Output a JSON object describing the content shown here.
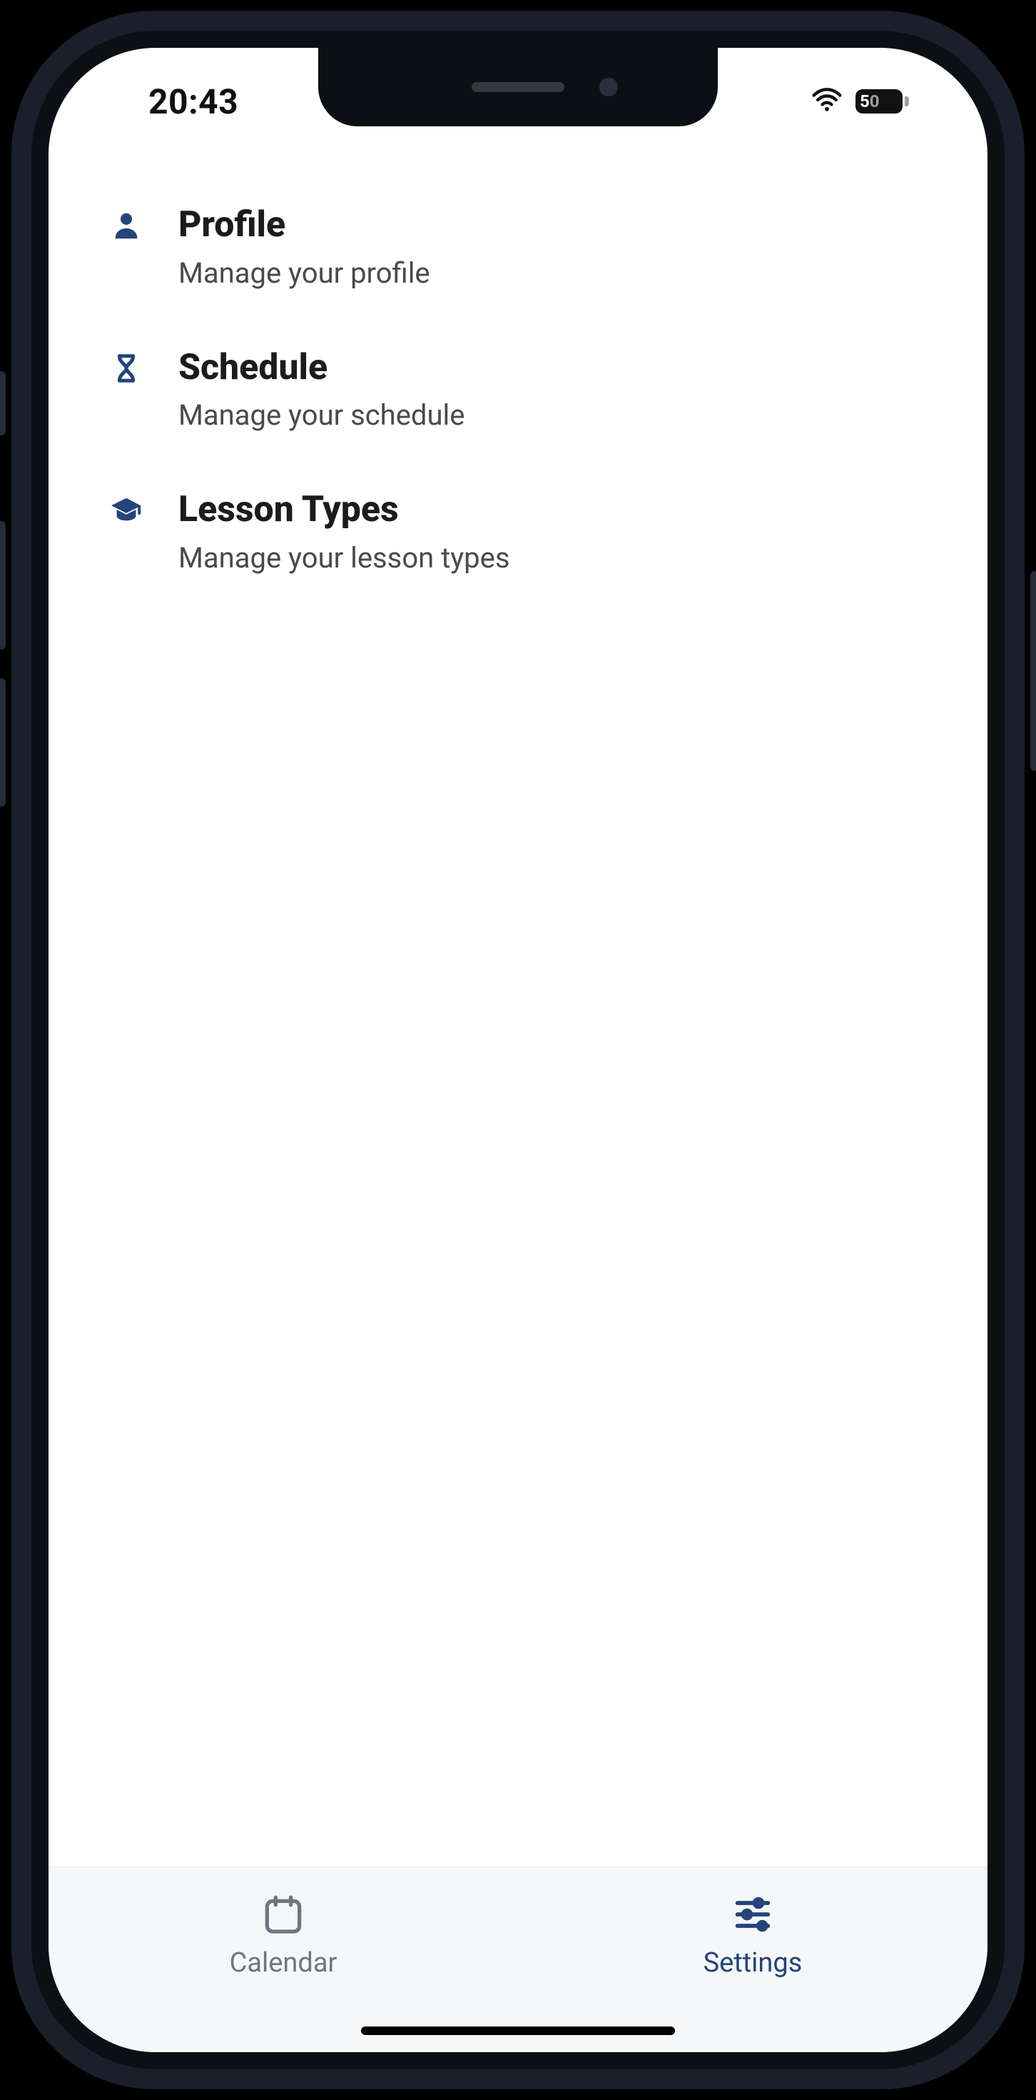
{
  "statusbar": {
    "time": "20:43",
    "battery_level": "50"
  },
  "settings": {
    "items": [
      {
        "icon": "user-icon",
        "title": "Profile",
        "subtitle": "Manage your profile"
      },
      {
        "icon": "hourglass-icon",
        "title": "Schedule",
        "subtitle": "Manage your schedule"
      },
      {
        "icon": "graduation-cap-icon",
        "title": "Lesson Types",
        "subtitle": "Manage your lesson types"
      }
    ]
  },
  "tabs": {
    "calendar": {
      "label": "Calendar",
      "active": false
    },
    "settings": {
      "label": "Settings",
      "active": true
    }
  },
  "colors": {
    "accent": "#24457a",
    "inactive": "#6f7680"
  }
}
